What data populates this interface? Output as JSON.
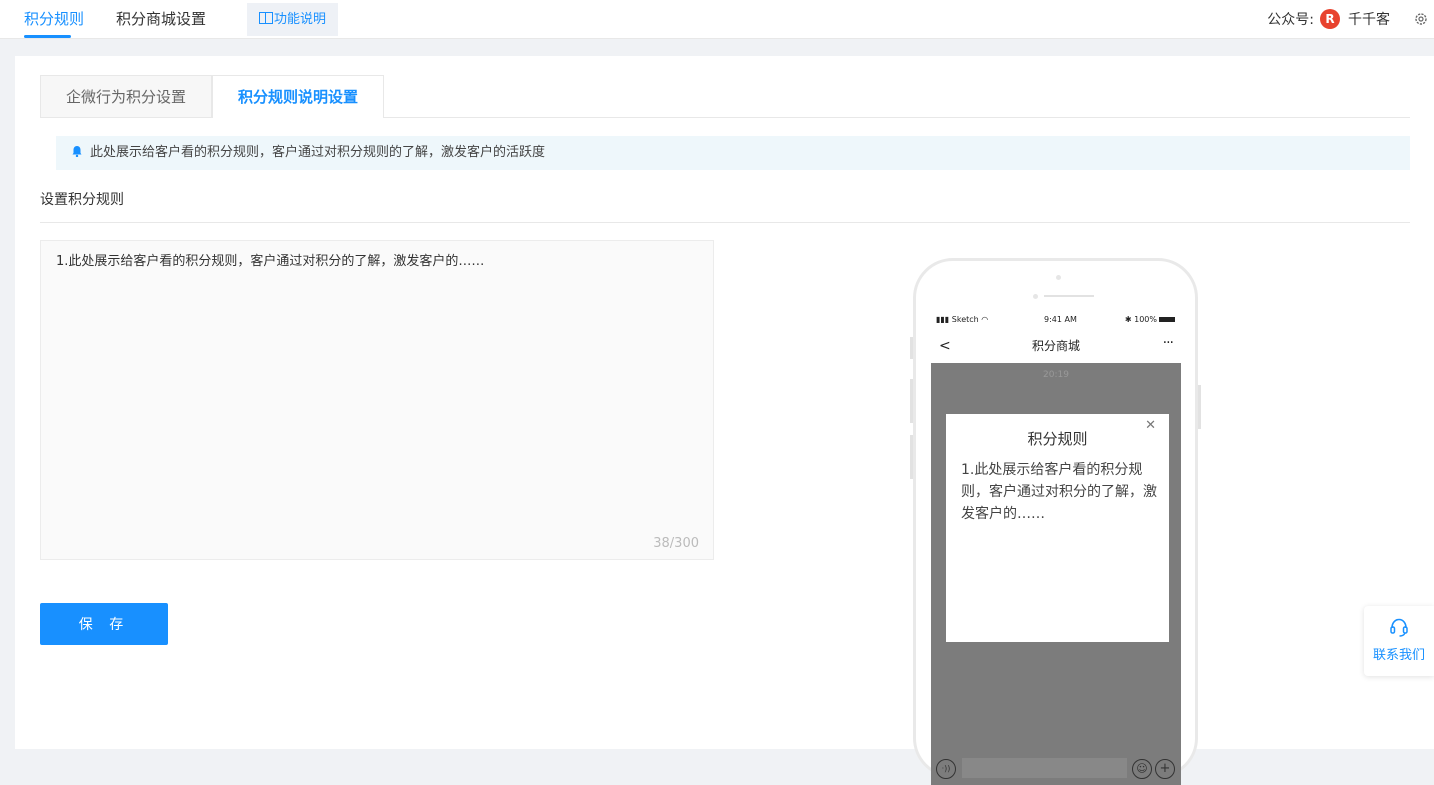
{
  "topnav": {
    "tabs": [
      {
        "label": "积分规则",
        "active": true
      },
      {
        "label": "积分商城设置",
        "active": false
      }
    ],
    "help_label": "功能说明",
    "account_prefix": "公众号:",
    "avatar_letter": "R",
    "account_name": "千千客"
  },
  "subtabs": [
    {
      "label": "企微行为积分设置",
      "active": false
    },
    {
      "label": "积分规则说明设置",
      "active": true
    }
  ],
  "notice": "此处展示给客户看的积分规则，客户通过对积分规则的了解，激发客户的活跃度",
  "section_title": "设置积分规则",
  "rules_text": "1.此处展示给客户看的积分规则，客户通过对积分的了解，激发客户的……",
  "char_count": "38/300",
  "save_label": "保 存",
  "phone": {
    "carrier": "Sketch",
    "time": "9:41 AM",
    "battery": "100%",
    "page_title": "积分商城",
    "chat_time": "20:19",
    "modal_title": "积分规则",
    "modal_body": "1.此处展示给客户看的积分规则，客户通过对积分的了解，激发客户的……"
  },
  "contact_label": "联系我们",
  "colors": {
    "accent": "#1890ff",
    "avatar": "#e8432e",
    "notice_bg": "#eef7fb"
  }
}
